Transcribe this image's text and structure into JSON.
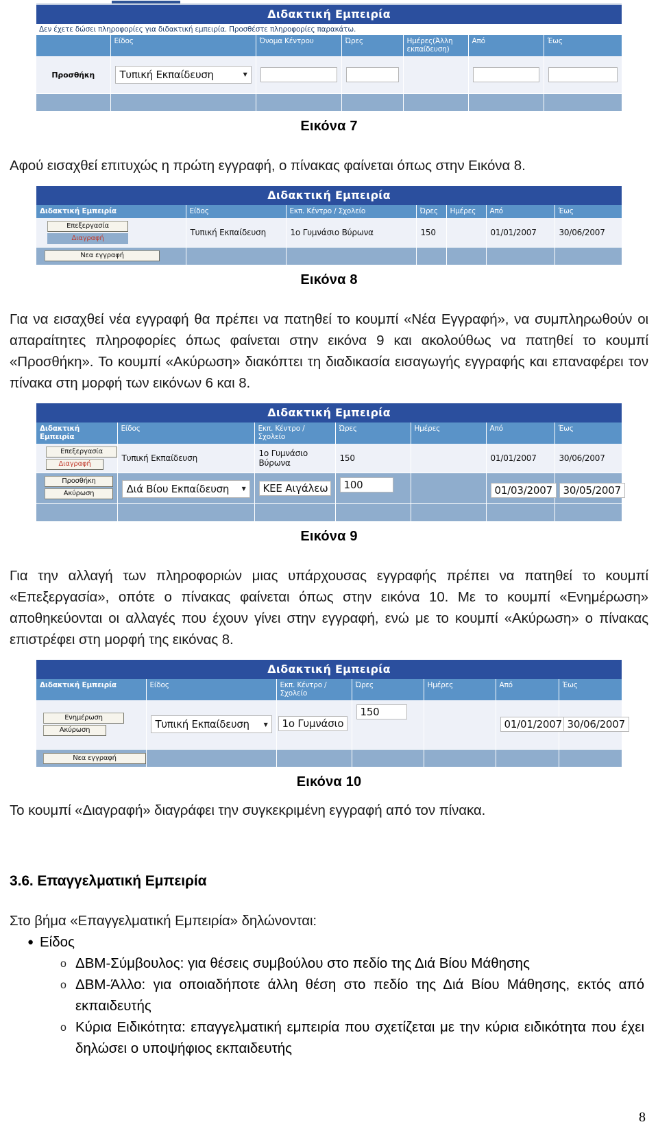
{
  "document": {
    "page_number": "8",
    "section_heading": "3.6. Επαγγελματική Εμπειρία",
    "paragraphs": {
      "p1": "Αφού εισαχθεί επιτυχώς η πρώτη εγγραφή, ο πίνακας φαίνεται όπως στην Εικόνα 8.",
      "p2": "Για να εισαχθεί νέα εγγραφή θα πρέπει να πατηθεί το κουμπί «Νέα Εγγραφή», να συμπληρωθούν οι απαραίτητες πληροφορίες όπως φαίνεται στην εικόνα 9 και ακολούθως να πατηθεί το κουμπί «Προσθήκη». Το κουμπί «Ακύρωση» διακόπτει τη διαδικασία εισαγωγής εγγραφής και επαναφέρει τον πίνακα στη μορφή των εικόνων 6 και 8.",
      "p3": "Για την αλλαγή των πληροφοριών μιας υπάρχουσας εγγραφής πρέπει να πατηθεί το κουμπί «Επεξεργασία», οπότε ο πίνακας φαίνεται όπως στην εικόνα 10. Με το κουμπί «Ενημέρωση» αποθηκεύονται οι αλλαγές που έχουν γίνει στην εγγραφή, ενώ με το κουμπί «Ακύρωση» ο πίνακας επιστρέφει στη μορφή της εικόνας 8.",
      "p4": "Το κουμπί «Διαγραφή» διαγράφει την συγκεκριμένη εγγραφή από τον πίνακα.",
      "p5": "Στο βήμα «Επαγγελματική Εμπειρία» δηλώνονται:"
    },
    "captions": {
      "fig7": "Εικόνα 7",
      "fig8": "Εικόνα 8",
      "fig9": "Εικόνα 9",
      "fig10": "Εικόνα 10"
    },
    "bullets": {
      "lvl1_label": "Είδος",
      "items": [
        "ΔΒΜ-Σύμβουλος: για θέσεις συμβούλου στο πεδίο της Διά Βίου Μάθησης",
        "ΔΒΜ-Άλλο: για οποιαδήποτε άλλη θέση στο πεδίο της Διά Βίου Μάθησης, εκτός από εκπαιδευτής",
        "Κύρια Ειδικότητα: επαγγελματική εμπειρία που σχετίζεται με την κύρια ειδικότητα που έχει δηλώσει ο υποψήφιος εκπαιδευτής"
      ]
    }
  },
  "colors": {
    "title_bar": "#2b4f9e",
    "header_row": "#5a93c8",
    "band_row": "#8fadcd",
    "cell_bg": "#eef1f8",
    "delete_link": "#c0392b"
  },
  "figure7": {
    "title": "Διδακτική Εμπειρία",
    "notice": "Δεν έχετε δώσει πληροφορίες για διδακτική εμπειρία. Προσθέστε πληροφορίες παρακάτω.",
    "headers": [
      "",
      "Είδος",
      "Όνομα Κέντρου",
      "Ώρες",
      "Ημέρες(Άλλη εκπαίδευση)",
      "Από",
      "Έως"
    ],
    "row": {
      "action_label": "Προσθήκη",
      "eidos_value": "Τυπική Εκπαίδευση",
      "onoma_kentrou_value": "",
      "ores_value": "",
      "imeres_value": "",
      "apo_value": "",
      "eos_value": ""
    }
  },
  "figure8": {
    "title": "Διδακτική Εμπειρία",
    "headers": [
      "Διδακτική Εμπειρία",
      "Είδος",
      "Εκπ. Κέντρο / Σχολείο",
      "Ώρες",
      "Ημέρες",
      "Από",
      "Έως"
    ],
    "record": {
      "edit_label": "Επεξεργασία",
      "delete_label": "Διαγραφή",
      "eidos": "Τυπική Εκπαίδευση",
      "kentro": "1ο Γυμνάσιο Βύρωνα",
      "ores": "150",
      "imeres": "",
      "apo": "01/01/2007",
      "eos": "30/06/2007"
    },
    "footer": {
      "new_label": "Νεα εγγραφή"
    }
  },
  "figure9": {
    "title": "Διδακτική Εμπειρία",
    "headers": [
      "Διδακτική Εμπειρία",
      "Είδος",
      "Εκπ. Κέντρο / Σχολείο",
      "Ώρες",
      "Ημέρες",
      "Από",
      "Έως"
    ],
    "record": {
      "edit_label": "Επεξεργασία",
      "delete_label": "Διαγραφή",
      "eidos": "Τυπική Εκπαίδευση",
      "kentro": "1ο Γυμνάσιο Βύρωνα",
      "ores": "150",
      "imeres": "",
      "apo": "01/01/2007",
      "eos": "30/06/2007"
    },
    "new_row": {
      "add_label": "Προσθήκη",
      "cancel_label": "Ακύρωση",
      "eidos_value": "Διά Βίου Εκπαίδευση",
      "kentro_value": "ΚΕΕ Αιγάλεω",
      "ores_value": "100",
      "imeres_value": "",
      "apo_value": "01/03/2007",
      "eos_value": "30/05/2007"
    }
  },
  "figure10": {
    "title": "Διδακτική Εμπειρία",
    "headers": [
      "Διδακτική Εμπειρία",
      "Είδος",
      "Εκπ. Κέντρο / Σχολείο",
      "Ώρες",
      "Ημέρες",
      "Από",
      "Έως"
    ],
    "edit_row": {
      "update_label": "Ενημέρωση",
      "cancel_label": "Ακύρωση",
      "eidos_value": "Τυπική Εκπαίδευση",
      "kentro_value": "1ο Γυμνάσιο",
      "ores_value": "150",
      "imeres_value": "",
      "apo_value": "01/01/2007",
      "eos_value": "30/06/2007"
    },
    "footer": {
      "new_label": "Νεα εγγραφή"
    }
  }
}
